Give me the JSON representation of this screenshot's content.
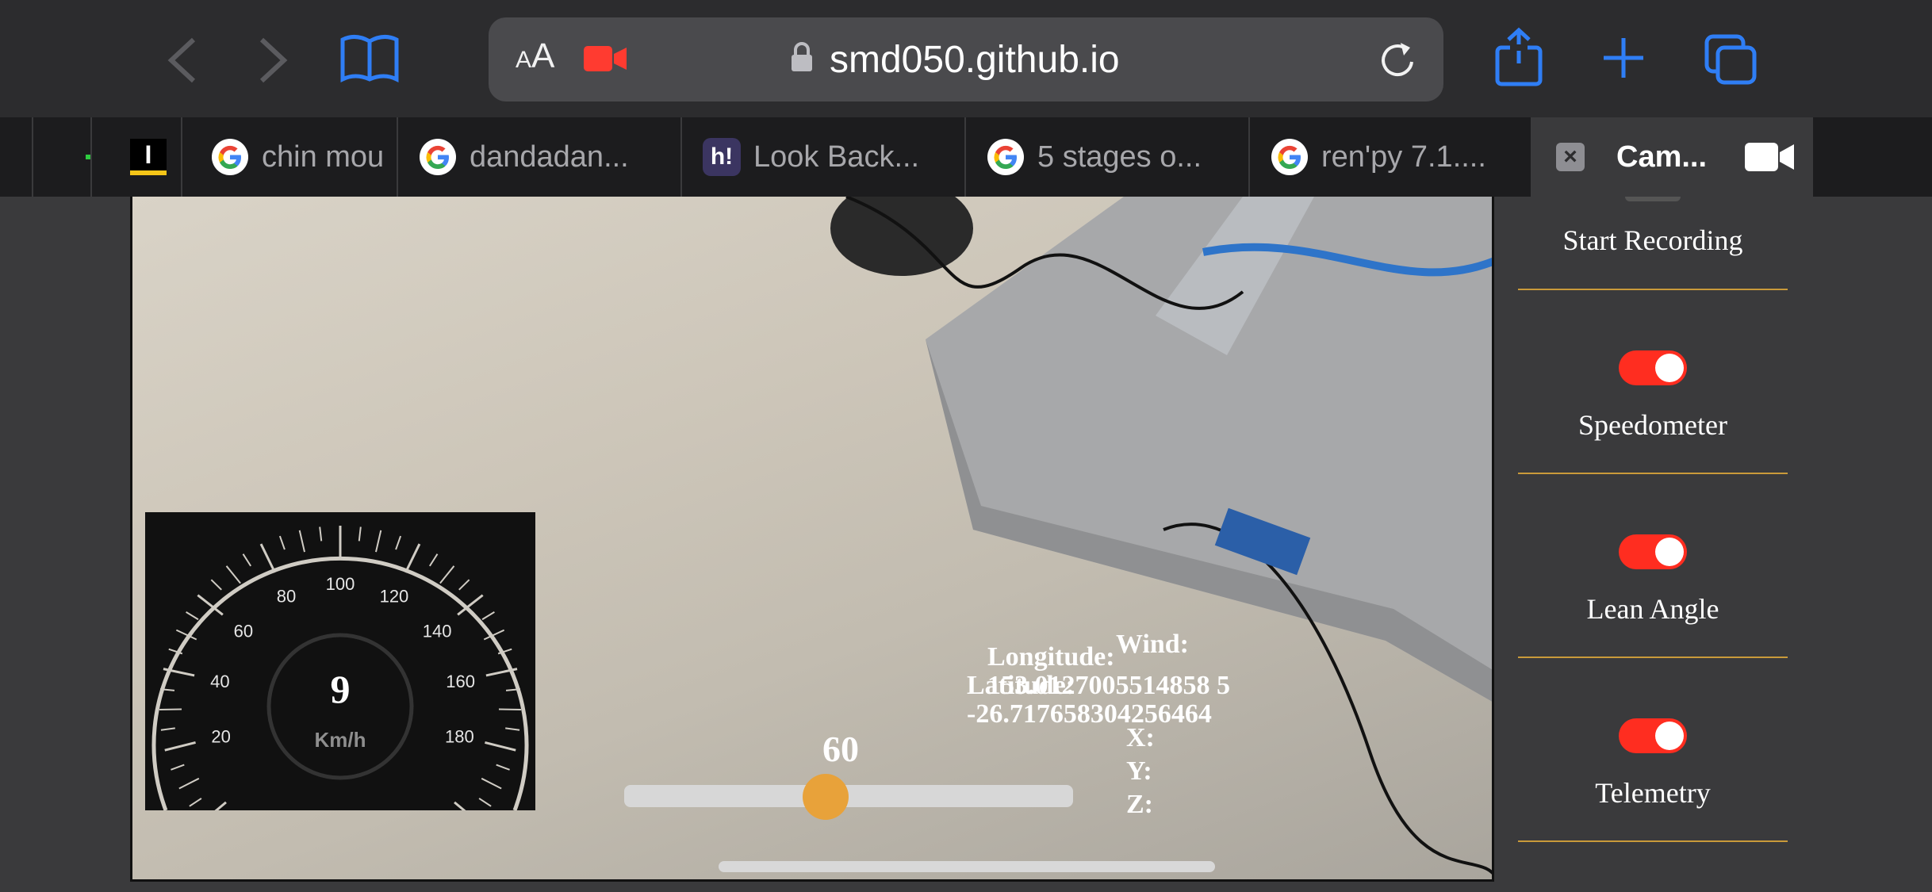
{
  "toolbar": {
    "text_size_label_small": "A",
    "text_size_label_large": "A",
    "url": "smd050.github.io",
    "accent_color": "#2f7ef5",
    "icons": [
      "back-chevron-icon",
      "forward-chevron-icon",
      "bookmarks-book-icon",
      "camera-recording-icon",
      "lock-icon",
      "reload-icon",
      "share-icon",
      "new-tab-plus-icon",
      "tabs-overview-icon"
    ]
  },
  "tabs": [
    {
      "label": "",
      "icon": "site-icon"
    },
    {
      "label": "",
      "icon": "site-icon"
    },
    {
      "label": "",
      "icon": "i-logo-icon"
    },
    {
      "label": "chin mou",
      "icon": "google-icon"
    },
    {
      "label": "dandadan...",
      "icon": "google-icon"
    },
    {
      "label": "Look Back...",
      "icon": "h-logo-icon"
    },
    {
      "label": "5 stages o...",
      "icon": "google-icon"
    },
    {
      "label": "ren'py 7.1....",
      "icon": "google-icon"
    },
    {
      "label": "Cam...",
      "icon": "close-tab-icon",
      "active": true
    }
  ],
  "sidebar": {
    "items": [
      {
        "label": "Start Recording"
      },
      {
        "label": "Speedometer",
        "on": true
      },
      {
        "label": "Lean Angle",
        "on": true
      },
      {
        "label": "Telemetry",
        "on": true
      }
    ],
    "toggle_color": "#ff2d20",
    "divider_color": "#c99a3a"
  },
  "speedometer": {
    "speed": "9",
    "unit": "Km/h",
    "ticks": [
      "20",
      "40",
      "60",
      "80",
      "100",
      "120",
      "140",
      "160",
      "180"
    ]
  },
  "telemetry": {
    "longitude_label": "Longitude:",
    "longitude_value": "153.0127005514858 5",
    "latitude_label": "Latitude:",
    "latitude_value": "-26.717658304256464",
    "wind_label": "Wind:",
    "x_label": "X:",
    "y_label": "Y:",
    "z_label": "Z:"
  },
  "slider": {
    "value": "60",
    "fraction": 0.6,
    "thumb_color": "#e8a23a"
  }
}
